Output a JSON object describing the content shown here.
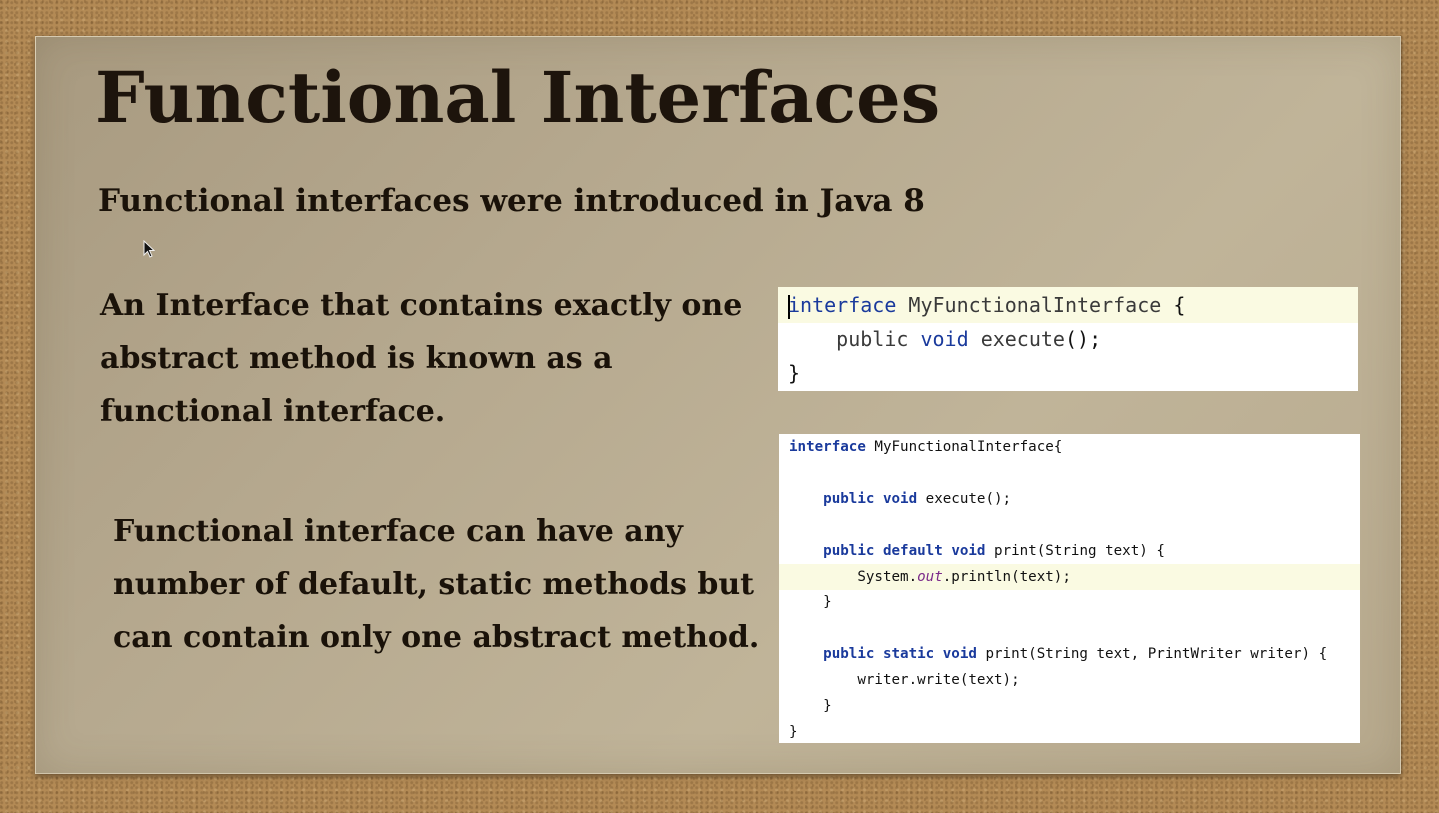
{
  "slide": {
    "title": "Functional Interfaces",
    "intro": "Functional interfaces were introduced in Java 8",
    "definition": "An Interface that contains exactly one abstract method is known as a functional interface.",
    "note": "Functional interface can have any number of default, static methods but can contain only one abstract method."
  },
  "code_snippet_1": {
    "lines": [
      [
        "interface",
        " ",
        "MyFunctionalInterface",
        " {"
      ],
      [
        "    ",
        "public",
        " ",
        "void",
        " ",
        "execute",
        "();"
      ],
      [
        "}"
      ]
    ]
  },
  "code_snippet_2": {
    "lines": [
      "interface MyFunctionalInterface{",
      "",
      "    public void execute();",
      "",
      "    public default void print(String text) {",
      "        System.out.println(text);",
      "    }",
      "",
      "    public static void print(String text, PrintWriter writer) {",
      "        writer.write(text);",
      "    }",
      "}"
    ]
  },
  "icons": {
    "cursor": "mouse-pointer-icon"
  },
  "colors": {
    "background": "#b38a55",
    "paper": "#b6a98f",
    "keyword": "#1a3a9c",
    "line_highlight": "#fafae2"
  }
}
